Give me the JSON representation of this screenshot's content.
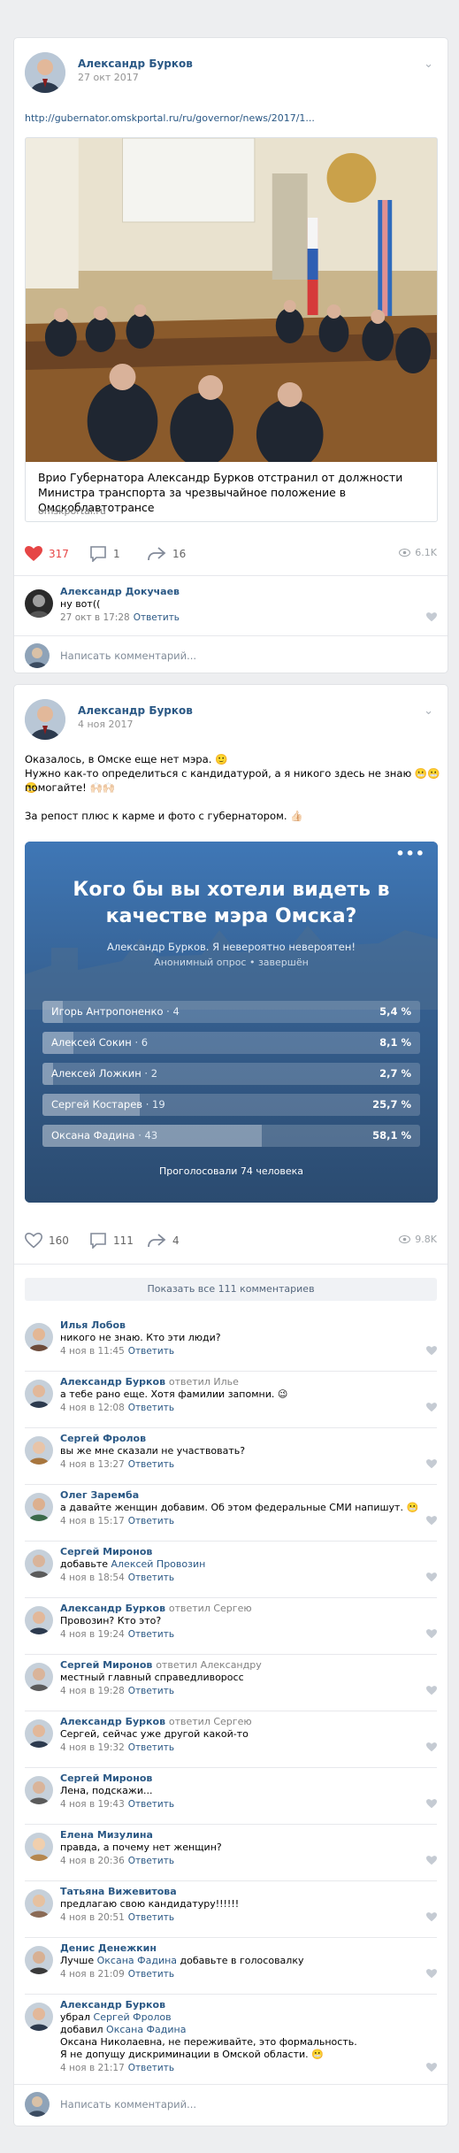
{
  "post1": {
    "author": "Александр Бурков",
    "date": "27 окт 2017",
    "url": "http://gubernator.omskportal.ru/ru/governor/news/2017/1...",
    "link_title": "Врио Губернатора Александр Бурков отстранил от должности Министра транспорта за чрезвычайное положение в Омскоблавтотрансе",
    "link_source": "omskportal.ru",
    "likes": "317",
    "comments": "1",
    "shares": "16",
    "views": "6.1K",
    "comment": {
      "name": "Александр Докучаев",
      "text": "ну вот((",
      "date": "27 окт в 17:28",
      "reply": "Ответить"
    },
    "write_placeholder": "Написать комментарий..."
  },
  "post2": {
    "author": "Александр Бурков",
    "date": "4 ноя 2017",
    "text_line1": "Оказалось, в Омске еще нет мэра. 🙂",
    "text_line2": "Нужно как-то определиться с кандидатурой, а я никого здесь не знаю 😬😬😬",
    "text_line3": "помогайте! 🙌🏻🙌🏻",
    "text_line4": "За репост плюс к карме и фото с губернатором. 👍🏻",
    "poll": {
      "more": "•••",
      "question": "Кого бы вы хотели видеть в качестве мэра Омска?",
      "subtitle": "Александр Бурков. Я невероятно невероятен!",
      "meta": "Анонимный опрос • завершён",
      "options": [
        {
          "name": "Игорь Антропоненко",
          "count": "· 4",
          "pct": "5,4 %",
          "value": 5.4
        },
        {
          "name": "Алексей Сокин",
          "count": "· 6",
          "pct": "8,1 %",
          "value": 8.1
        },
        {
          "name": "Алексей Ложкин",
          "count": "· 2",
          "pct": "2,7 %",
          "value": 2.7
        },
        {
          "name": "Сергей Костарев",
          "count": "· 19",
          "pct": "25,7 %",
          "value": 25.7
        },
        {
          "name": "Оксана Фадина",
          "count": "· 43",
          "pct": "58,1 %",
          "value": 58.1
        }
      ],
      "total": "Проголосовали 74 человека"
    },
    "likes": "160",
    "comments": "111",
    "shares": "4",
    "views": "9.8K",
    "show_all": "Показать все 111 комментариев",
    "reply_label": "Ответить",
    "comments_list": [
      {
        "name": "Илья Лобов",
        "replyto": "",
        "text": "никого не знаю. Кто эти люди?",
        "date": "4 ноя в 11:45"
      },
      {
        "name": "Александр Бурков",
        "replyto": "ответил Илье",
        "text": "а тебе рано еще. Хотя фамилии запомни. 😉",
        "date": "4 ноя в 12:08"
      },
      {
        "name": "Сергей Фролов",
        "replyto": "",
        "text": "вы же мне сказали не участвовать?",
        "date": "4 ноя в 13:27"
      },
      {
        "name": "Олег Зарембa",
        "replyto": "",
        "text": "а давайте женщин добавим.  Об этом федеральные СМИ напишут. 😬",
        "date": "4 ноя в 15:17"
      },
      {
        "name": "Сергей Миронов",
        "replyto": "",
        "text_pre": "добавьте ",
        "text_link": "Алексей Провозин",
        "date": "4 ноя в 18:54"
      },
      {
        "name": "Александр Бурков",
        "replyto": "ответил Сергею",
        "text": "Провозин? Кто это?",
        "date": "4 ноя в 19:24"
      },
      {
        "name": "Сергей Миронов",
        "replyto": "ответил Александру",
        "text": "местный главный справедливоросс",
        "date": "4 ноя в 19:28"
      },
      {
        "name": "Александр Бурков",
        "replyto": "ответил Сергею",
        "text": "Сергей, сейчас уже другой какой-то",
        "date": "4 ноя в 19:32"
      },
      {
        "name": "Сергей Миронов",
        "replyto": "",
        "text": "Лена, подскажи...",
        "date": "4 ноя в 19:43"
      },
      {
        "name": "Елена Мизулина",
        "replyto": "",
        "text": "правда, а почему нет женщин?",
        "date": "4 ноя в 20:36"
      },
      {
        "name": "Татьяна Вижевитова",
        "replyto": "",
        "text": "предлагаю свою кандидатуру!!!!!!",
        "date": "4 ноя в 20:51"
      },
      {
        "name": "Денис Денежкин",
        "replyto": "",
        "text_pre": "Лучше ",
        "text_link": "Оксана Фадина",
        "text_post": " добавьте в голосовалку",
        "date": "4 ноя в 21:09"
      },
      {
        "name": "Александр Бурков",
        "replyto": "",
        "l1_pre": "убрал ",
        "l1_link": "Сергей Фролов",
        "l2_pre": "добавил ",
        "l2_link": "Оксана Фадина",
        "l3": "Оксана Николаевна, не переживайте, это формальность.",
        "l4": "Я не допущу дискриминации в Омской области. 😬",
        "date": "4 ноя в 21:17"
      }
    ],
    "write_placeholder": "Написать комментарий..."
  },
  "colors": {
    "link": "#2a5885",
    "like_red": "#e64646",
    "poll_bg": "#3d5f86"
  }
}
